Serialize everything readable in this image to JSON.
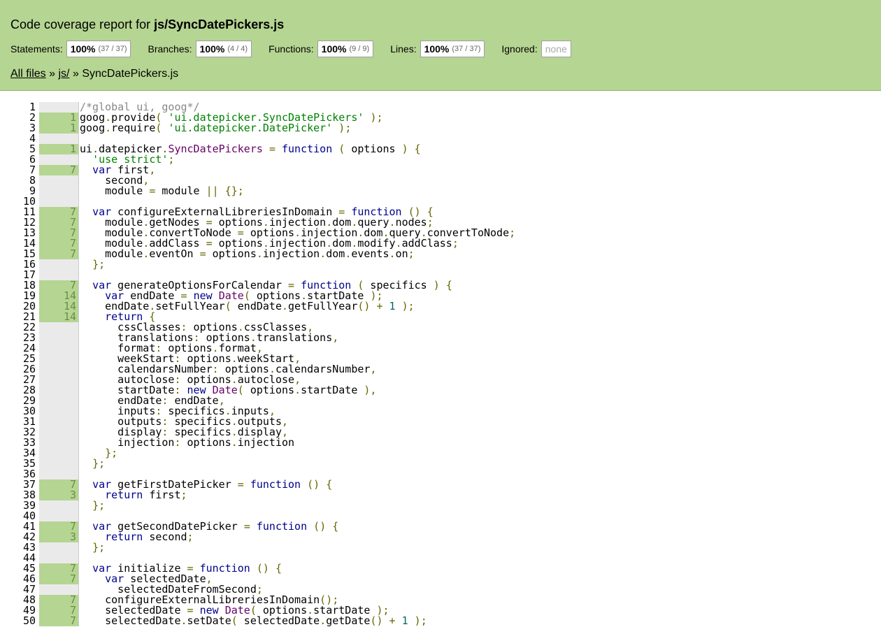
{
  "header": {
    "title_prefix": "Code coverage report for",
    "title_file": "js/SyncDatePickers.js"
  },
  "stats": [
    {
      "label": "Statements:",
      "pct": "100%",
      "frac": "(37 / 37)"
    },
    {
      "label": "Branches:",
      "pct": "100%",
      "frac": "(4 / 4)"
    },
    {
      "label": "Functions:",
      "pct": "100%",
      "frac": "(9 / 9)"
    },
    {
      "label": "Lines:",
      "pct": "100%",
      "frac": "(37 / 37)"
    }
  ],
  "ignored": {
    "label": "Ignored:",
    "value": "none"
  },
  "breadcrumb": {
    "all_files": "All files",
    "sep1": "»",
    "dir": "js/",
    "sep2": "»",
    "file": "SyncDatePickers.js"
  },
  "code": {
    "line_numbers": [
      "1",
      "2",
      "3",
      "4",
      "5",
      "6",
      "7",
      "8",
      "9",
      "10",
      "11",
      "12",
      "13",
      "14",
      "15",
      "16",
      "17",
      "18",
      "19",
      "20",
      "21",
      "22",
      "23",
      "24",
      "25",
      "26",
      "27",
      "28",
      "29",
      "30",
      "31",
      "32",
      "33",
      "34",
      "35",
      "36",
      "37",
      "38",
      "39",
      "40",
      "41",
      "42",
      "43",
      "44",
      "45",
      "46",
      "47",
      "48",
      "49",
      "50"
    ],
    "hits": [
      "",
      "1",
      "1",
      "",
      "1",
      "",
      "7",
      "",
      "",
      "",
      "7",
      "7",
      "7",
      "7",
      "7",
      "",
      "",
      "7",
      "14",
      "14",
      "14",
      "",
      "",
      "",
      "",
      "",
      "",
      "",
      "",
      "",
      "",
      "",
      "",
      "",
      "",
      "",
      "7",
      "3",
      "",
      "",
      "7",
      "3",
      "",
      "",
      "7",
      "7",
      "",
      "7",
      "7",
      "7"
    ],
    "covered": [
      false,
      true,
      true,
      false,
      true,
      false,
      true,
      false,
      false,
      false,
      true,
      true,
      true,
      true,
      true,
      false,
      false,
      true,
      true,
      true,
      true,
      false,
      false,
      false,
      false,
      false,
      false,
      false,
      false,
      false,
      false,
      false,
      false,
      false,
      false,
      false,
      true,
      true,
      false,
      false,
      true,
      true,
      false,
      false,
      true,
      true,
      false,
      true,
      true,
      true
    ],
    "lines": [
      "/*global ui, goog*/",
      "goog.provide( 'ui.datepicker.SyncDatePickers' );",
      "goog.require( 'ui.datepicker.DatePicker' );",
      "",
      "ui.datepicker.SyncDatePickers = function ( options ) {",
      "  'use strict';",
      "  var first,",
      "    second,",
      "    module = module || {};",
      "",
      "  var configureExternalLibreriesInDomain = function () {",
      "    module.getNodes = options.injection.dom.query.nodes;",
      "    module.convertToNode = options.injection.dom.query.convertToNode;",
      "    module.addClass = options.injection.dom.modify.addClass;",
      "    module.eventOn = options.injection.dom.events.on;",
      "  };",
      "",
      "  var generateOptionsForCalendar = function ( specifics ) {",
      "    var endDate = new Date( options.startDate );",
      "    endDate.setFullYear( endDate.getFullYear() + 1 );",
      "    return {",
      "      cssClasses: options.cssClasses,",
      "      translations: options.translations,",
      "      format: options.format,",
      "      weekStart: options.weekStart,",
      "      calendarsNumber: options.calendarsNumber,",
      "      autoclose: options.autoclose,",
      "      startDate: new Date( options.startDate ),",
      "      endDate: endDate,",
      "      inputs: specifics.inputs,",
      "      outputs: specifics.outputs,",
      "      display: specifics.display,",
      "      injection: options.injection",
      "    };",
      "  };",
      "",
      "  var getFirstDatePicker = function () {",
      "    return first;",
      "  };",
      "",
      "  var getSecondDatePicker = function () {",
      "    return second;",
      "  };",
      "",
      "  var initialize = function () {",
      "    var selectedDate,",
      "      selectedDateFromSecond;",
      "    configureExternalLibreriesInDomain();",
      "    selectedDate = new Date( options.startDate );",
      "    selectedDate.setDate( selectedDate.getDate() + 1 );"
    ]
  }
}
